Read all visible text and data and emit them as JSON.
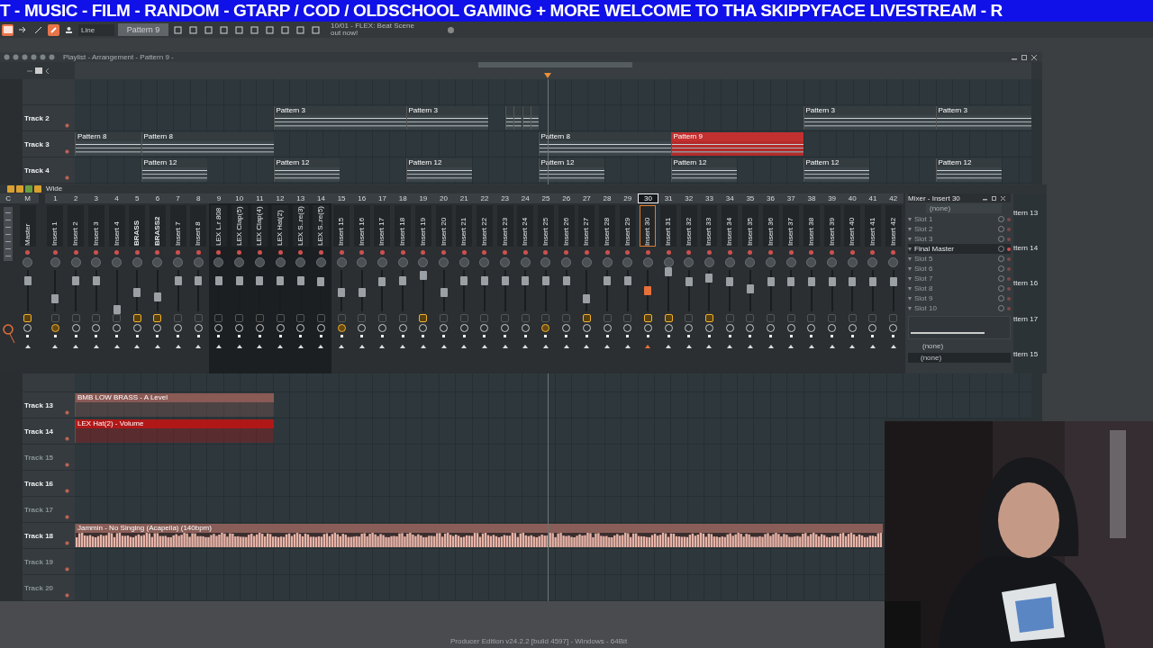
{
  "banner": {
    "text": "T - MUSIC - FILM - RANDOM - GTARP / COD / OLDSCHOOL GAMING + MORE  WELCOME TO THA SKIPPYFACE LIVESTREAM  - R"
  },
  "toolbar": {
    "snap": "Line",
    "pattern": "Pattern 9",
    "hint_title": "10/01 - FLEX: Beat Scene",
    "hint_body": "out now!"
  },
  "playlist": {
    "title": "Playlist - Arrangement - Pattern 9 -",
    "upper_tracks": [
      {
        "label": "Track 2",
        "dimmed": false,
        "clips": [
          {
            "kind": "pattern",
            "label": "Pattern 3",
            "selected": false
          },
          {
            "kind": "pattern",
            "label": "Pattern 3",
            "selected": false
          },
          {
            "kind": "pattern",
            "selected": false
          },
          {
            "kind": "pattern",
            "selected": false
          },
          {
            "kind": "pattern",
            "selected": false
          },
          {
            "kind": "pattern",
            "selected": false
          },
          {
            "kind": "pattern",
            "label": "Pattern 3",
            "selected": false
          },
          {
            "kind": "pattern",
            "label": "Pattern 3",
            "selected": false
          }
        ]
      },
      {
        "label": "Track 3",
        "dimmed": false,
        "clips": [
          {
            "kind": "pattern",
            "label": "Pattern 8",
            "selected": false
          },
          {
            "kind": "pattern",
            "label": "Pattern 8",
            "selected": false
          },
          {
            "kind": "pattern",
            "label": "Pattern 8",
            "selected": false
          },
          {
            "kind": "pattern",
            "label": "Pattern 9",
            "selected": true
          }
        ]
      },
      {
        "label": "Track 4",
        "dimmed": false,
        "clips": [
          {
            "kind": "pattern",
            "label": "Pattern 12",
            "selected": false
          },
          {
            "kind": "pattern",
            "label": "Pattern 12",
            "selected": false
          },
          {
            "kind": "pattern",
            "label": "Pattern 12",
            "selected": false
          },
          {
            "kind": "pattern",
            "label": "Pattern 12",
            "selected": false
          },
          {
            "kind": "pattern",
            "label": "Pattern 12",
            "selected": false
          },
          {
            "kind": "pattern",
            "label": "Pattern 12",
            "selected": false
          },
          {
            "kind": "pattern",
            "label": "Pattern 12",
            "selected": false
          }
        ]
      }
    ],
    "lower_tracks": [
      {
        "label": "Track 13",
        "dimmed": false,
        "clips": [
          {
            "kind": "automation",
            "label": "BMB LOW BRASS - A Level",
            "color": "#8a5a55"
          }
        ]
      },
      {
        "label": "Track 14",
        "dimmed": false,
        "clips": [
          {
            "kind": "automation",
            "label": "LEX Hat(2) - Volume",
            "color": "#b01818"
          }
        ]
      },
      {
        "label": "Track 15",
        "dimmed": true
      },
      {
        "label": "Track 16",
        "dimmed": false
      },
      {
        "label": "Track 17",
        "dimmed": true
      },
      {
        "label": "Track 18",
        "dimmed": false,
        "clips": [
          {
            "kind": "audio",
            "label": "Jammin - No Singing (Acapella) (140bpm)"
          }
        ]
      },
      {
        "label": "Track 19",
        "dimmed": true
      },
      {
        "label": "Track 20",
        "dimmed": true
      }
    ]
  },
  "mixer": {
    "stereo_mode": "Wide",
    "meter_label": "C",
    "strips": [
      {
        "number": "M",
        "name": "Master",
        "level": 0.75,
        "selected": false,
        "armed": true,
        "tagged": false,
        "shaded": false
      },
      {
        "number": "1",
        "name": "Insert 1",
        "level": 0.3,
        "selected": false,
        "armed": false,
        "tagged": true,
        "shaded": false
      },
      {
        "number": "2",
        "name": "Insert 2",
        "level": 0.75,
        "selected": false,
        "armed": false,
        "tagged": false,
        "shaded": false
      },
      {
        "number": "3",
        "name": "Insert 3",
        "level": 0.75,
        "selected": false,
        "armed": false,
        "tagged": false,
        "shaded": false
      },
      {
        "number": "4",
        "name": "Insert 4",
        "level": 0.05,
        "selected": false,
        "armed": false,
        "tagged": false,
        "shaded": false
      },
      {
        "number": "5",
        "name": "BRASS",
        "level": 0.45,
        "selected": false,
        "armed": true,
        "tagged": false,
        "shaded": false
      },
      {
        "number": "6",
        "name": "BRASS2",
        "level": 0.35,
        "selected": false,
        "armed": true,
        "tagged": false,
        "shaded": false
      },
      {
        "number": "7",
        "name": "Insert 7",
        "level": 0.75,
        "selected": false,
        "armed": false,
        "tagged": false,
        "shaded": false
      },
      {
        "number": "8",
        "name": "Insert 8",
        "level": 0.75,
        "selected": false,
        "armed": false,
        "tagged": false,
        "shaded": false
      },
      {
        "number": "9",
        "name": "LEX L.r 808",
        "level": 0.75,
        "selected": false,
        "armed": false,
        "tagged": false,
        "shaded": true
      },
      {
        "number": "10",
        "name": "LEX Clap(5)",
        "level": 0.75,
        "selected": false,
        "armed": false,
        "tagged": false,
        "shaded": true
      },
      {
        "number": "11",
        "name": "LEX Clap(4)",
        "level": 0.75,
        "selected": false,
        "armed": false,
        "tagged": false,
        "shaded": true
      },
      {
        "number": "12",
        "name": "LEX Hat(2)",
        "level": 0.75,
        "selected": false,
        "armed": false,
        "tagged": false,
        "shaded": true
      },
      {
        "number": "13",
        "name": "LEX S..re(3)",
        "level": 0.75,
        "selected": false,
        "armed": false,
        "tagged": false,
        "shaded": true
      },
      {
        "number": "14",
        "name": "LEX S..re(5)",
        "level": 0.72,
        "selected": false,
        "armed": false,
        "tagged": false,
        "shaded": true
      },
      {
        "number": "15",
        "name": "Insert 15",
        "level": 0.45,
        "selected": false,
        "armed": false,
        "tagged": true,
        "shaded": false
      },
      {
        "number": "16",
        "name": "Insert 16",
        "level": 0.45,
        "selected": false,
        "armed": false,
        "tagged": false,
        "shaded": false
      },
      {
        "number": "17",
        "name": "Insert 17",
        "level": 0.72,
        "selected": false,
        "armed": false,
        "tagged": false,
        "shaded": false
      },
      {
        "number": "18",
        "name": "Insert 18",
        "level": 0.75,
        "selected": false,
        "armed": false,
        "tagged": false,
        "shaded": false
      },
      {
        "number": "19",
        "name": "Insert 19",
        "level": 0.88,
        "selected": false,
        "armed": true,
        "tagged": false,
        "shaded": false
      },
      {
        "number": "20",
        "name": "Insert 20",
        "level": 0.45,
        "selected": false,
        "armed": false,
        "tagged": false,
        "shaded": false
      },
      {
        "number": "21",
        "name": "Insert 21",
        "level": 0.75,
        "selected": false,
        "armed": false,
        "tagged": false,
        "shaded": false
      },
      {
        "number": "22",
        "name": "Insert 22",
        "level": 0.75,
        "selected": false,
        "armed": false,
        "tagged": false,
        "shaded": false
      },
      {
        "number": "23",
        "name": "Insert 23",
        "level": 0.75,
        "selected": false,
        "armed": false,
        "tagged": false,
        "shaded": false
      },
      {
        "number": "24",
        "name": "Insert 24",
        "level": 0.75,
        "selected": false,
        "armed": false,
        "tagged": false,
        "shaded": false
      },
      {
        "number": "25",
        "name": "Insert 25",
        "level": 0.75,
        "selected": false,
        "armed": false,
        "tagged": true,
        "shaded": false
      },
      {
        "number": "26",
        "name": "Insert 26",
        "level": 0.75,
        "selected": false,
        "armed": false,
        "tagged": false,
        "shaded": false
      },
      {
        "number": "27",
        "name": "Insert 27",
        "level": 0.3,
        "selected": false,
        "armed": true,
        "tagged": false,
        "shaded": false
      },
      {
        "number": "28",
        "name": "Insert 28",
        "level": 0.75,
        "selected": false,
        "armed": false,
        "tagged": false,
        "shaded": false
      },
      {
        "number": "29",
        "name": "Insert 29",
        "level": 0.75,
        "selected": false,
        "armed": false,
        "tagged": false,
        "shaded": false
      },
      {
        "number": "30",
        "name": "Insert 30",
        "level": 0.5,
        "selected": true,
        "armed": true,
        "tagged": false,
        "shaded": false
      },
      {
        "number": "31",
        "name": "Insert 31",
        "level": 0.95,
        "selected": false,
        "armed": true,
        "tagged": false,
        "shaded": false
      },
      {
        "number": "32",
        "name": "Insert 32",
        "level": 0.72,
        "selected": false,
        "armed": false,
        "tagged": false,
        "shaded": false
      },
      {
        "number": "33",
        "name": "Insert 33",
        "level": 0.8,
        "selected": false,
        "armed": true,
        "tagged": false,
        "shaded": false
      },
      {
        "number": "34",
        "name": "Insert 34",
        "level": 0.72,
        "selected": false,
        "armed": false,
        "tagged": false,
        "shaded": false
      },
      {
        "number": "35",
        "name": "Insert 35",
        "level": 0.55,
        "selected": false,
        "armed": false,
        "tagged": false,
        "shaded": false
      },
      {
        "number": "36",
        "name": "Insert 36",
        "level": 0.72,
        "selected": false,
        "armed": false,
        "tagged": false,
        "shaded": false
      },
      {
        "number": "37",
        "name": "Insert 37",
        "level": 0.72,
        "selected": false,
        "armed": false,
        "tagged": false,
        "shaded": false
      },
      {
        "number": "38",
        "name": "Insert 38",
        "level": 0.72,
        "selected": false,
        "armed": false,
        "tagged": false,
        "shaded": false
      },
      {
        "number": "39",
        "name": "Insert 39",
        "level": 0.72,
        "selected": false,
        "armed": false,
        "tagged": false,
        "shaded": false
      },
      {
        "number": "40",
        "name": "Insert 40",
        "level": 0.72,
        "selected": false,
        "armed": false,
        "tagged": false,
        "shaded": false
      },
      {
        "number": "41",
        "name": "Insert 41",
        "level": 0.72,
        "selected": false,
        "armed": false,
        "tagged": false,
        "shaded": false
      },
      {
        "number": "42",
        "name": "Insert 42",
        "level": 0.72,
        "selected": false,
        "armed": false,
        "tagged": false,
        "shaded": false
      }
    ]
  },
  "insert_panel": {
    "title": "Mixer - Insert 30",
    "preset": "(none)",
    "slots": [
      {
        "label": "Slot 1",
        "empty": true
      },
      {
        "label": "Slot 2",
        "empty": true
      },
      {
        "label": "Slot 3",
        "empty": true
      },
      {
        "label": "Final Master",
        "empty": false
      },
      {
        "label": "Slot 5",
        "empty": true
      },
      {
        "label": "Slot 6",
        "empty": true
      },
      {
        "label": "Slot 7",
        "empty": true
      },
      {
        "label": "Slot 8",
        "empty": true
      },
      {
        "label": "Slot 9",
        "empty": true
      },
      {
        "label": "Slot 10",
        "empty": true
      }
    ],
    "eq_preset": "(none)",
    "output": "(none)"
  },
  "side_labels": [
    "ttern 13",
    "ttern 14",
    "ttern 16",
    "ttern 17",
    "ttern 15"
  ],
  "status_bar": {
    "text": "Producer Edition v24.2.2 [build 4597] - Windows - 64Bit"
  }
}
